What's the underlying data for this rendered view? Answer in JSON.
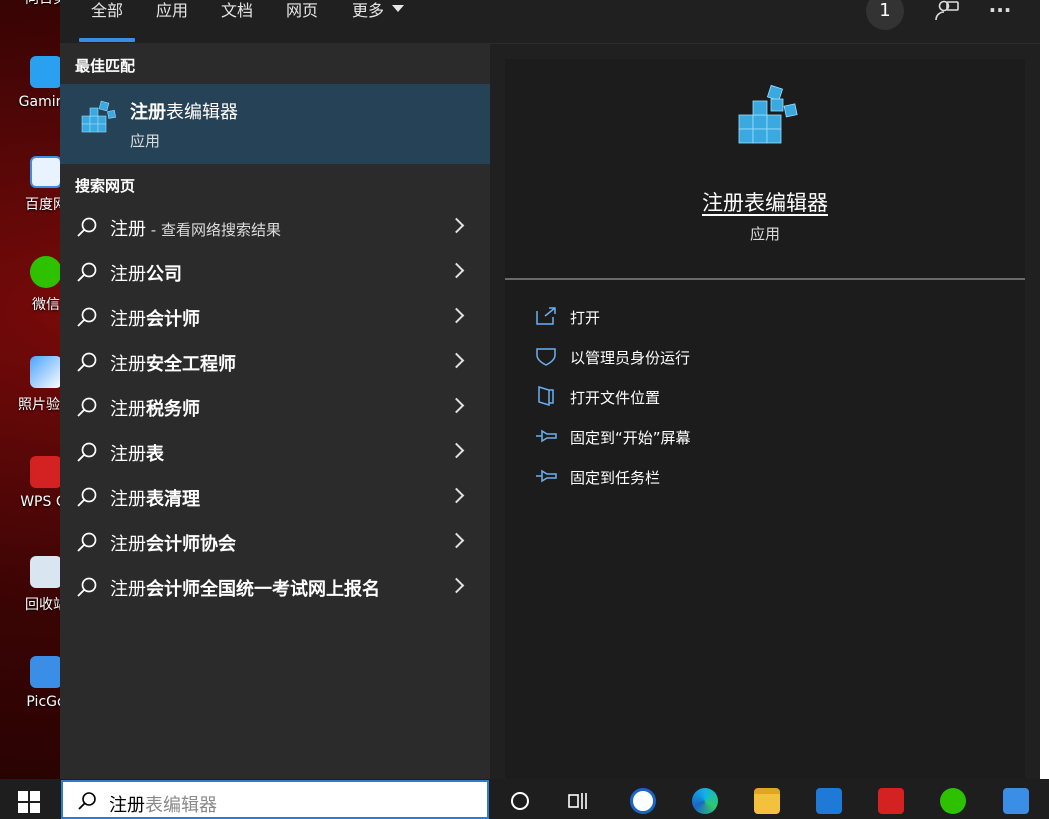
{
  "desktop": {
    "icons": [
      {
        "label": "向日葵",
        "color": "#1b7fe0"
      },
      {
        "label": "Gaming",
        "color": "#2aa0f0"
      },
      {
        "label": "百度网",
        "color": "#e9f2ff"
      },
      {
        "label": "微信",
        "color": "#2dc100"
      },
      {
        "label": "照片验证",
        "color": "#4aa3ff"
      },
      {
        "label": "WPS Of",
        "color": "#d42121"
      },
      {
        "label": "回收站",
        "color": "#d9e6f2"
      },
      {
        "label": "PicGo",
        "color": "#3a8ee6"
      }
    ]
  },
  "tabs": [
    {
      "label": "全部"
    },
    {
      "label": "应用"
    },
    {
      "label": "文档"
    },
    {
      "label": "网页"
    },
    {
      "label": "更多"
    }
  ],
  "header": {
    "badge": "1",
    "feedback_icon": "feedback-icon",
    "more_icon": "ellipsis-icon"
  },
  "left": {
    "best_match_title": "最佳匹配",
    "best_match": {
      "title_bold": "注册",
      "title_rest": "表编辑器",
      "subtitle": "应用"
    },
    "web_title": "搜索网页",
    "web_results": [
      {
        "normal": "注册",
        "bold": "",
        "hint": " - 查看网络搜索结果"
      },
      {
        "normal": "注册",
        "bold": "公司",
        "hint": ""
      },
      {
        "normal": "注册",
        "bold": "会计师",
        "hint": ""
      },
      {
        "normal": "注册",
        "bold": "安全工程师",
        "hint": ""
      },
      {
        "normal": "注册",
        "bold": "税务师",
        "hint": ""
      },
      {
        "normal": "注册",
        "bold": "表",
        "hint": ""
      },
      {
        "normal": "注册",
        "bold": "表清理",
        "hint": ""
      },
      {
        "normal": "注册",
        "bold": "会计师协会",
        "hint": ""
      },
      {
        "normal": "注册",
        "bold": "会计师全国统一考试网上报名",
        "hint": ""
      }
    ]
  },
  "detail": {
    "title": "注册表编辑器",
    "subtitle": "应用",
    "actions": [
      {
        "label": "打开",
        "icon": "open-icon"
      },
      {
        "label": "以管理员身份运行",
        "icon": "shield-icon"
      },
      {
        "label": "打开文件位置",
        "icon": "file-location-icon"
      },
      {
        "label": "固定到“开始”屏幕",
        "icon": "pin-start-icon"
      },
      {
        "label": "固定到任务栏",
        "icon": "pin-taskbar-icon"
      }
    ]
  },
  "taskbar": {
    "search_typed": "注册",
    "search_suggestion": "表编辑器",
    "colors": {
      "accent": "#2f7bd2",
      "selected_row": "#264256",
      "panel": "#202020"
    }
  }
}
